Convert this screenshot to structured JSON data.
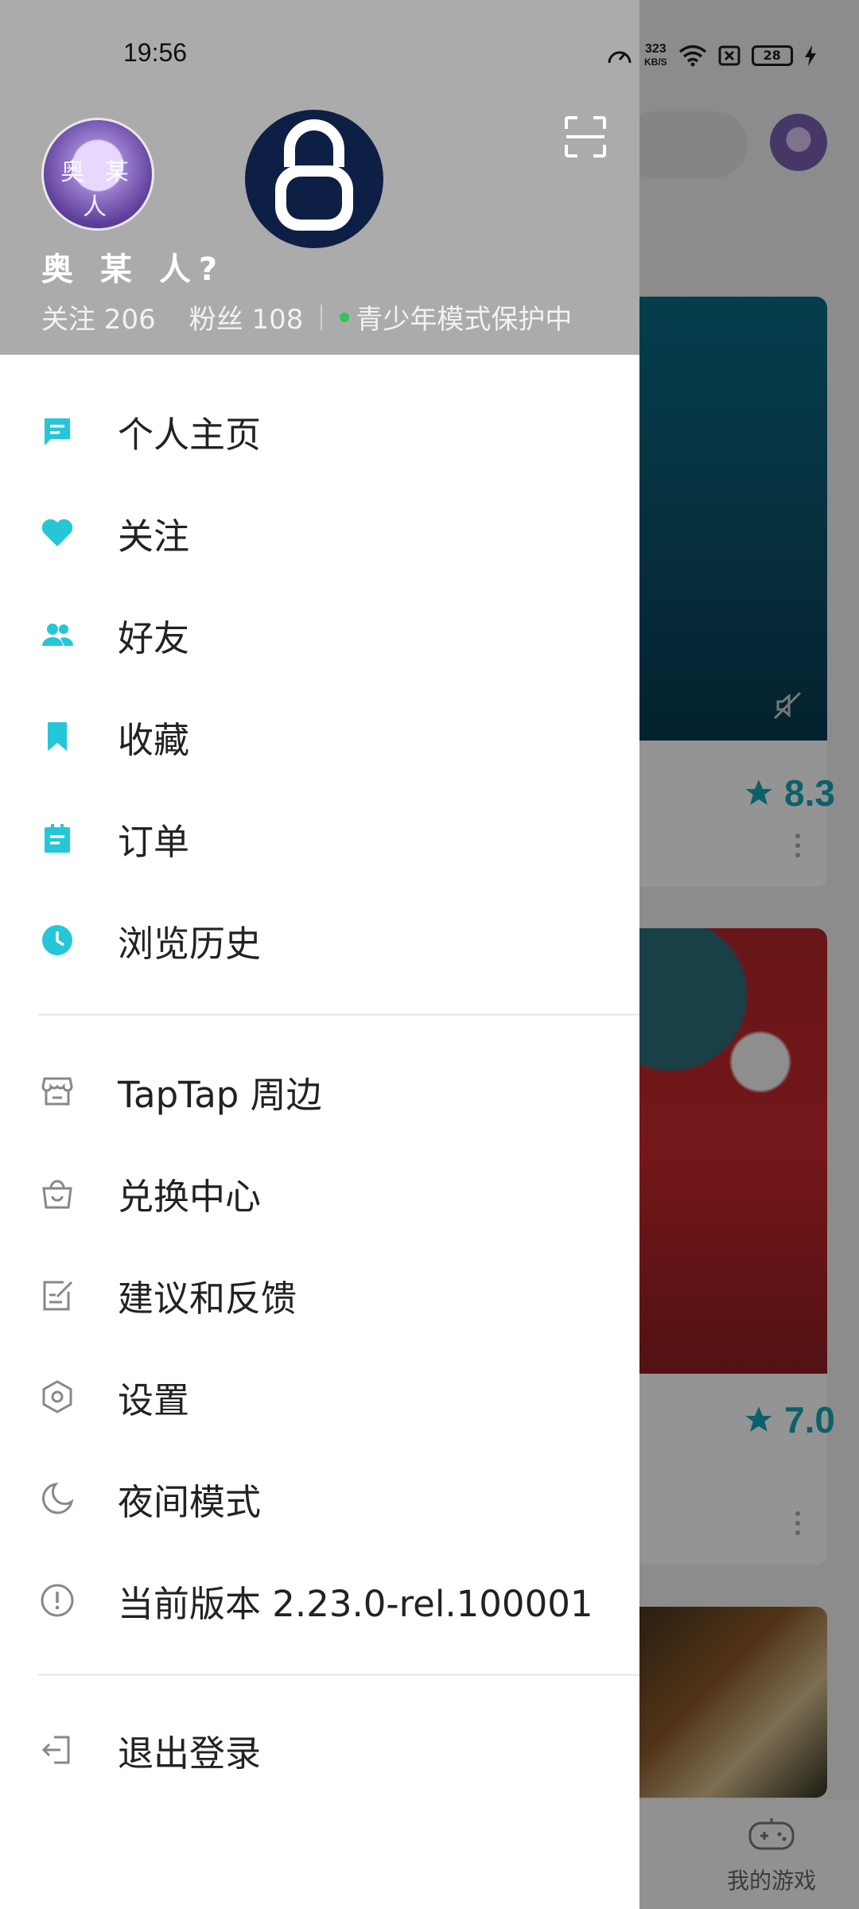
{
  "status_bar": {
    "time": "19:56",
    "net_speed_value": "323",
    "net_speed_unit": "KB/S",
    "battery": "28"
  },
  "profile": {
    "avatar_text": "奥 某 人",
    "name": "奥 某 人?",
    "following_label": "关注 206",
    "followers_label": "粉丝 108",
    "youth_mode": "青少年模式保护中"
  },
  "menu_primary": [
    {
      "label": "个人主页",
      "icon": "profile-icon"
    },
    {
      "label": "关注",
      "icon": "heart-icon"
    },
    {
      "label": "好友",
      "icon": "friends-icon"
    },
    {
      "label": "收藏",
      "icon": "bookmark-icon"
    },
    {
      "label": "订单",
      "icon": "order-icon"
    },
    {
      "label": "浏览历史",
      "icon": "clock-icon"
    }
  ],
  "menu_secondary": [
    {
      "label": "TapTap 周边",
      "icon": "store-icon"
    },
    {
      "label": "兑换中心",
      "icon": "bag-icon"
    },
    {
      "label": "建议和反馈",
      "icon": "feedback-icon"
    },
    {
      "label": "设置",
      "icon": "settings-icon"
    },
    {
      "label": "夜间模式",
      "icon": "moon-icon"
    },
    {
      "label": "当前版本 2.23.0-rel.100001",
      "icon": "info-icon"
    }
  ],
  "logout": {
    "label": "退出登录",
    "icon": "logout-icon"
  },
  "background_app": {
    "ratings": [
      "8.3",
      "7.0"
    ],
    "tab_my_games": "我的游戏"
  },
  "colors": {
    "accent": "#26c6d9",
    "rating": "#14a7b6",
    "header_bg": "#ababab",
    "lock_bg": "#0d1f44"
  }
}
